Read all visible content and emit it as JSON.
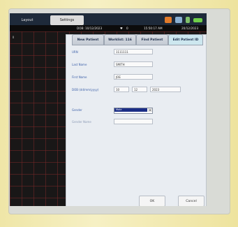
{
  "topbar": {
    "tab_layout": "Layout",
    "tab_settings": "Settings",
    "dob_label": "DOB:",
    "dob_value": "10/12/2023",
    "heart_value": "0",
    "time": "15:50:17 AM",
    "date": "20/12/2023"
  },
  "grid": {
    "label": "II"
  },
  "tabs": [
    "New Patient",
    "Worklist: 116",
    "Find Patient",
    "Edit Patient ID"
  ],
  "form": {
    "labels": {
      "urn": "URN",
      "last_name": "Last Name",
      "first_name": "First Name",
      "dob": "DOB (dd/mm/yyyy)",
      "gender": "Gender",
      "gender_name": "Gender Name"
    },
    "values": {
      "urn": "1111111",
      "last_name": "SMITH",
      "first_name": "JOE",
      "dob_day": "10",
      "dob_month": "12",
      "dob_year": "2023",
      "gender": "Male",
      "gender_name": ""
    }
  },
  "buttons": {
    "ok": "OK",
    "cancel": "Cancel"
  },
  "colors": {
    "accent": "#1b2e86",
    "label": "#3b5fa8"
  }
}
